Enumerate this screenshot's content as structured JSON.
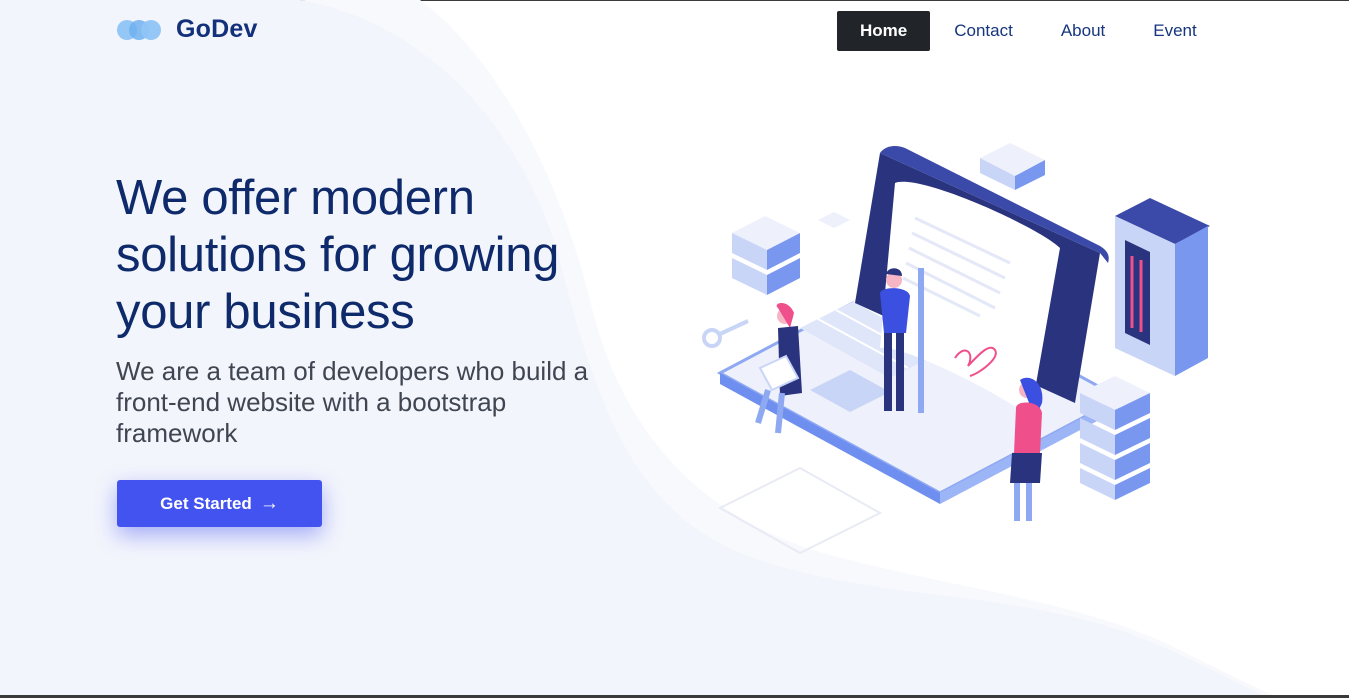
{
  "brand": {
    "name": "GoDev",
    "logo_icon": "three-circles-logo-icon"
  },
  "nav": {
    "items": [
      {
        "label": "Home",
        "active": true
      },
      {
        "label": "Contact",
        "active": false
      },
      {
        "label": "About",
        "active": false
      },
      {
        "label": "Event",
        "active": false
      }
    ]
  },
  "hero": {
    "title_lines": [
      "We offer modern",
      "solutions for growing",
      "your business"
    ],
    "subtitle_lines": [
      "We are a team of developers who build a",
      "front-end website with a bootstrap",
      "framework"
    ],
    "cta_label": "Get Started",
    "cta_icon": "arrow-right-icon"
  },
  "colors": {
    "brand_text": "#13307a",
    "accent": "#4353f0",
    "nav_active_bg": "#212529",
    "hero_bg": "#f3f5fc"
  }
}
